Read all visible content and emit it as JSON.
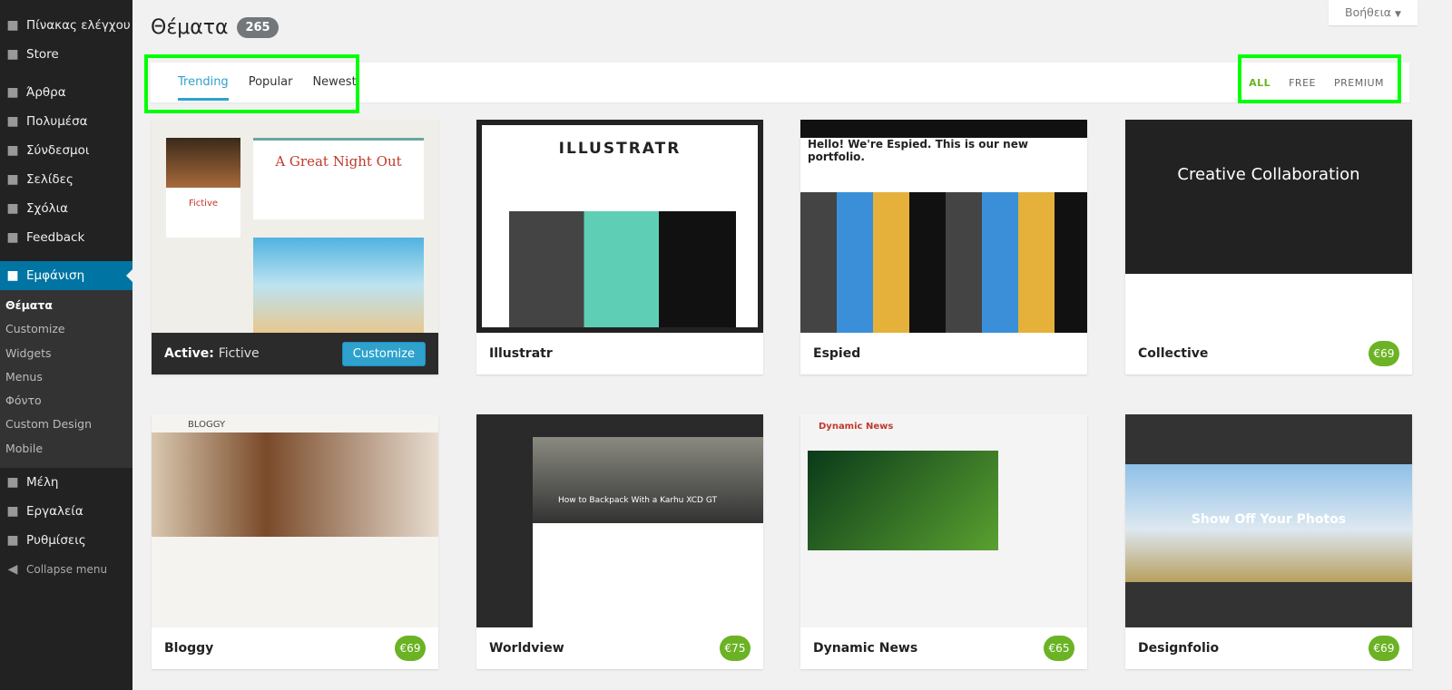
{
  "sidebar": {
    "items": [
      {
        "label": "Πίνακας ελέγχου",
        "icon": "dashboard-icon"
      },
      {
        "label": "Store",
        "icon": "cart-icon"
      },
      {
        "label": "Άρθρα",
        "icon": "pin-icon"
      },
      {
        "label": "Πολυμέσα",
        "icon": "media-icon"
      },
      {
        "label": "Σύνδεσμοι",
        "icon": "link-icon"
      },
      {
        "label": "Σελίδες",
        "icon": "pages-icon"
      },
      {
        "label": "Σχόλια",
        "icon": "comments-icon"
      },
      {
        "label": "Feedback",
        "icon": "feedback-icon"
      },
      {
        "label": "Εμφάνιση",
        "icon": "brush-icon"
      }
    ],
    "submenu": [
      "Θέματα",
      "Customize",
      "Widgets",
      "Menus",
      "Φόντο",
      "Custom Design",
      "Mobile"
    ],
    "items2": [
      {
        "label": "Μέλη",
        "icon": "user-icon"
      },
      {
        "label": "Εργαλεία",
        "icon": "wrench-icon"
      },
      {
        "label": "Ρυθμίσεις",
        "icon": "settings-icon"
      }
    ],
    "collapse": "Collapse menu"
  },
  "header": {
    "title": "Θέματα",
    "count": "265",
    "help": "Βοήθεια"
  },
  "tabs": [
    "Trending",
    "Popular",
    "Newest"
  ],
  "price_filters": [
    "ALL",
    "FREE",
    "PREMIUM"
  ],
  "colors": {
    "accent": "#2ea2cc",
    "price": "#6bb324",
    "highlight": "#00ff00"
  },
  "active": {
    "label": "Active:",
    "name": "Fictive",
    "button": "Customize"
  },
  "themes": [
    {
      "name": "Illustratr",
      "headline": "ILLUSTRATR",
      "price": ""
    },
    {
      "name": "Espied",
      "headline": "Hello! We're Espied. This is our new portfolio.",
      "price": ""
    },
    {
      "name": "Collective",
      "headline": "Creative Collaboration",
      "price": "€69"
    },
    {
      "name": "Bloggy",
      "headline": "BLOGGY",
      "price": "€69"
    },
    {
      "name": "Worldview",
      "headline": "How to Backpack With a Karhu XCD GT",
      "price": "€75"
    },
    {
      "name": "Dynamic News",
      "headline": "Dynamic News",
      "price": "€65"
    },
    {
      "name": "Designfolio",
      "headline": "Show Off Your Photos",
      "price": "€69"
    }
  ],
  "fictive_headline": "A Great Night Out"
}
